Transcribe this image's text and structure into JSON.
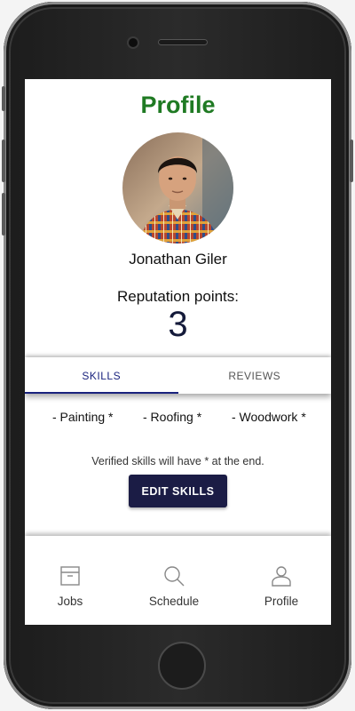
{
  "screen": {
    "title": "Profile"
  },
  "profile": {
    "name": "Jonathan Giler",
    "reputation_label": "Reputation points:",
    "reputation_value": "3"
  },
  "tabs": [
    {
      "label": "SKILLS",
      "active": true
    },
    {
      "label": "REVIEWS",
      "active": false
    }
  ],
  "skills": {
    "items": [
      "- Painting *",
      "- Roofing *",
      "- Woodwork *"
    ],
    "note": "Verified skills will have * at the end.",
    "edit_button": "EDIT SKILLS"
  },
  "bottom_nav": [
    {
      "label": "Jobs",
      "icon": "archive-box-icon"
    },
    {
      "label": "Schedule",
      "icon": "search-icon"
    },
    {
      "label": "Profile",
      "icon": "person-icon"
    }
  ],
  "colors": {
    "title_green": "#1f7a23",
    "accent_navy": "#1b1c45",
    "tab_active": "#1a237e"
  }
}
